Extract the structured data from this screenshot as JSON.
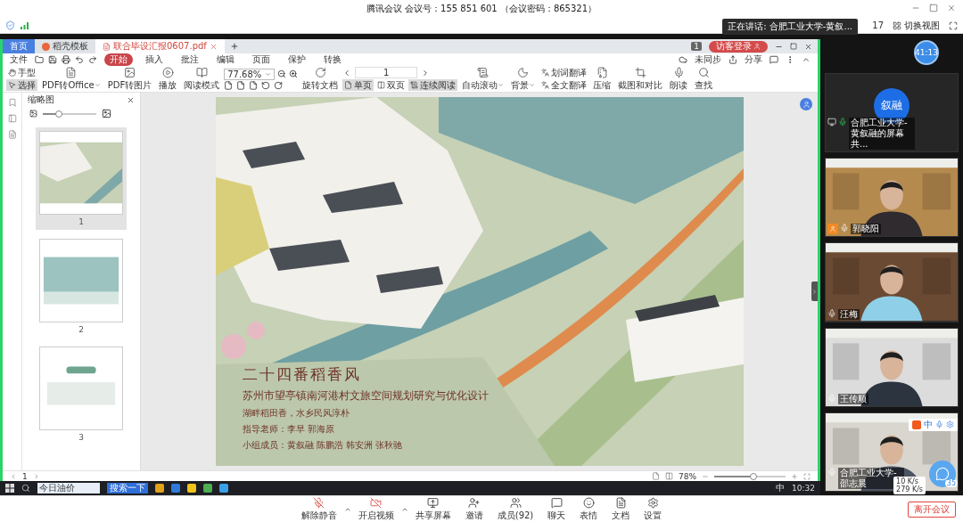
{
  "title_bar": {
    "title": "腾讯会议 会议号：155 851 601 （会议密码：865321）"
  },
  "info_bar": {
    "speaking_tooltip": "正在讲话: 合肥工业大学-黄叙...",
    "count": "17",
    "switch_view": "切换视图"
  },
  "wps": {
    "tabs": [
      {
        "label": "首页",
        "kind": "home",
        "selected": false
      },
      {
        "label": "稻壳模板",
        "kind": "template",
        "selected": false
      },
      {
        "label": "联合毕设汇报0607.pdf",
        "kind": "pdf",
        "selected": true
      }
    ],
    "badge_count": "1",
    "login_button": "访客登录",
    "file_menu": "文件",
    "ribbon_tabs": [
      {
        "label": "开始",
        "selected": true
      },
      {
        "label": "插入",
        "selected": false
      },
      {
        "label": "批注",
        "selected": false
      },
      {
        "label": "编辑",
        "selected": false
      },
      {
        "label": "页面",
        "selected": false
      },
      {
        "label": "保护",
        "selected": false
      },
      {
        "label": "转换",
        "selected": false
      }
    ],
    "sync": "未同步",
    "share": "分享",
    "toolbar": [
      {
        "kind": "stack",
        "items": [
          {
            "label": "手型",
            "selected": false
          },
          {
            "label": "选择",
            "selected": true
          }
        ]
      },
      {
        "kind": "large",
        "label": "PDF转Office",
        "dropdown": true
      },
      {
        "kind": "large",
        "label": "PDF转图片",
        "dropdown": false
      },
      {
        "kind": "large",
        "label": "播放",
        "dropdown": false
      },
      {
        "kind": "large",
        "label": "阅读模式",
        "dropdown": false
      },
      {
        "kind": "zoom",
        "value": "77.68%"
      },
      {
        "kind": "large",
        "label": "旋转文档",
        "dropdown": false
      },
      {
        "kind": "pager",
        "value": "1",
        "items": [
          {
            "label": "单页",
            "selected": true
          },
          {
            "label": "双页",
            "selected": false
          },
          {
            "label": "连续阅读",
            "selected": true
          }
        ]
      },
      {
        "kind": "large",
        "label": "自动滚动",
        "dropdown": true
      },
      {
        "kind": "large",
        "label": "背景",
        "dropdown": true
      },
      {
        "kind": "stack",
        "items": [
          {
            "label": "划词翻译",
            "selected": false
          },
          {
            "label": "全文翻译",
            "selected": false
          }
        ]
      },
      {
        "kind": "large",
        "label": "压缩",
        "dropdown": false
      },
      {
        "kind": "large",
        "label": "截图和对比",
        "dropdown": false
      },
      {
        "kind": "large",
        "label": "朗读",
        "dropdown": false
      },
      {
        "kind": "large",
        "label": "查找",
        "dropdown": false
      }
    ],
    "thumbnails": {
      "title": "缩略图",
      "level": 0.3,
      "pages": [
        {
          "label": "1",
          "selected": true
        },
        {
          "label": "2",
          "selected": false
        },
        {
          "label": "3",
          "selected": false
        }
      ]
    },
    "poster": {
      "title": "二十四番稻香风",
      "subtitle": "苏州市望亭镇南河港村文旅空间规划研究与优化设计",
      "lines": [
        "湖畔稻田香，水乡民风淳朴",
        "指导老师：李早  郭海原",
        "小组成员：黄叙融  陈鹏浩  韩安洲  张秋驰"
      ]
    },
    "status": {
      "page": "1",
      "zoom": "78%",
      "level": 0.55
    }
  },
  "taskbar": {
    "search": "今日油价",
    "search_button": "搜索一下",
    "ime": "中",
    "time": "10:32"
  },
  "timer": "41:13",
  "participants": [
    {
      "kind": "avatar",
      "initials": "叙融",
      "name": "合肥工业大学-黄叙融的屏幕共...",
      "speaking": true,
      "host": false
    },
    {
      "kind": "video",
      "name": "郭晓阳",
      "speaking": false,
      "host": true
    },
    {
      "kind": "video",
      "name": "汪梅",
      "speaking": false,
      "host": false
    },
    {
      "kind": "video",
      "name": "王传顺",
      "speaking": false,
      "host": false
    },
    {
      "kind": "video",
      "name": "合肥工业大学-邵志晨",
      "speaking": false,
      "host": false,
      "ime": "中"
    }
  ],
  "meeting_toolbar": [
    {
      "label": "解除静音",
      "off": true,
      "caret": true
    },
    {
      "label": "开启视频",
      "off": true,
      "caret": true
    },
    {
      "label": "共享屏幕",
      "off": false,
      "caret": false
    },
    {
      "label": "邀请",
      "off": false,
      "caret": false
    },
    {
      "label": "成员(92)",
      "off": false,
      "caret": false
    },
    {
      "label": "聊天",
      "off": false,
      "caret": false
    },
    {
      "label": "表情",
      "off": false,
      "caret": false
    },
    {
      "label": "文档",
      "off": false,
      "caret": false
    },
    {
      "label": "设置",
      "off": false,
      "caret": false
    }
  ],
  "network": {
    "up": "10 K/s",
    "down": "279 K/s"
  },
  "chat_badge": "35",
  "leave_button": "离开会议"
}
